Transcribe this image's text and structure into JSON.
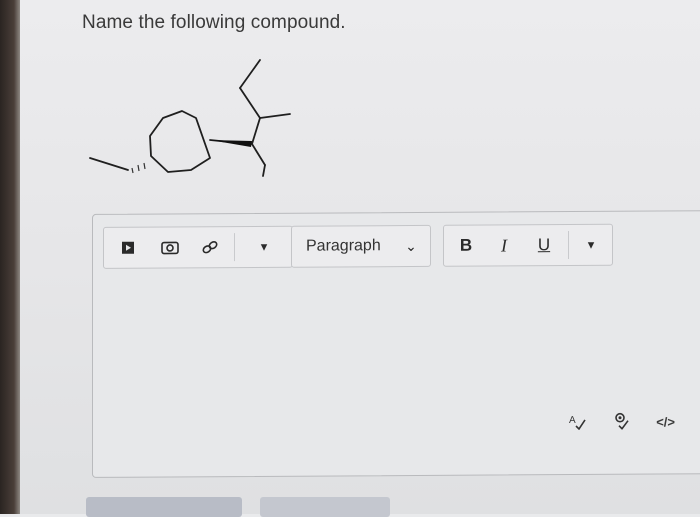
{
  "question": {
    "text": "Name the following compound."
  },
  "toolbar": {
    "insert_icons": [
      "video-icon",
      "image-icon",
      "link-icon"
    ],
    "more_dropdown_arrow": "▾",
    "block_format": {
      "selected": "Paragraph",
      "chevron": "⌄"
    },
    "format_buttons": {
      "bold": "B",
      "italic": "I",
      "underline": "U",
      "more_arrow": "▾"
    }
  },
  "editor_footer": {
    "spellcheck_icon": "spellcheck-icon",
    "accessibility_icon": "accessibility-check-icon",
    "source_code": "</>"
  },
  "colors": {
    "page_bg": "#e6e6e8",
    "text": "#3a3a3a",
    "border": "#b9babd"
  }
}
